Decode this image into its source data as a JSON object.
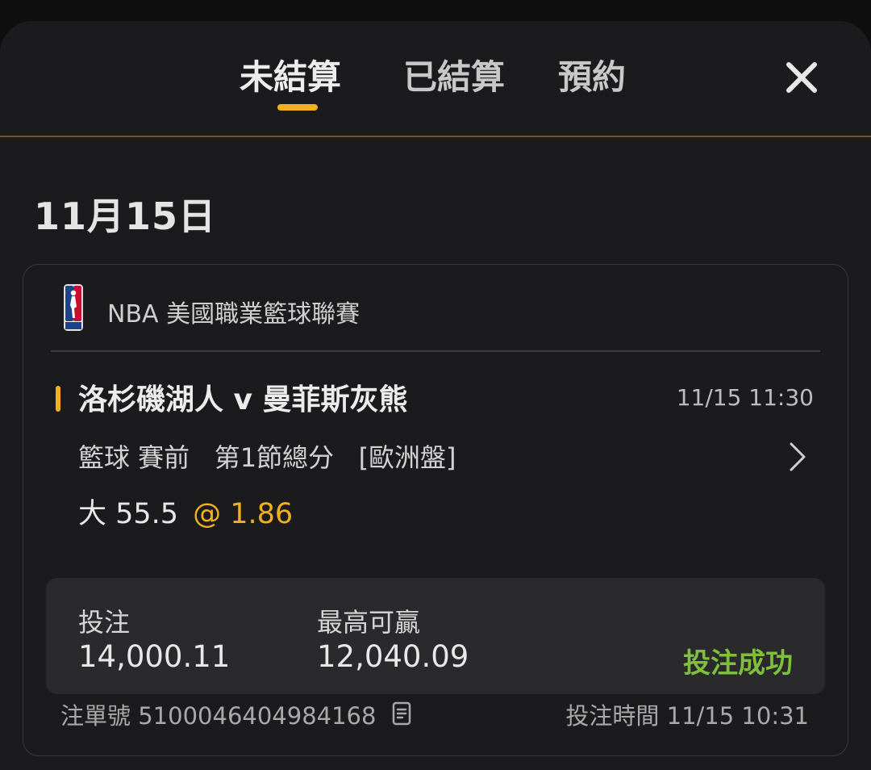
{
  "tabs": [
    {
      "label": "未結算",
      "active": true
    },
    {
      "label": "已結算",
      "active": false
    },
    {
      "label": "預約",
      "active": false
    }
  ],
  "date_heading": "11月15日",
  "bet": {
    "league": "NBA 美國職業籃球聯賽",
    "match_title": "洛杉磯湖人 v 曼菲斯灰熊",
    "match_time": "11/15 11:30",
    "market_info": "籃球 賽前   第1節總分   [歐洲盤]",
    "selection": "大 55.5",
    "odds": "@ 1.86",
    "stake_label": "投注",
    "stake_value": "14,000.11",
    "max_win_label": "最高可贏",
    "max_win_value": "12,040.09",
    "status": "投注成功",
    "ticket_label": "注單號",
    "ticket_number": "5100046404984168",
    "bet_time_label": "投注時間",
    "bet_time_value": "11/15 10:31"
  },
  "colors": {
    "accent": "#f2b01e",
    "success": "#7fbf3c",
    "background": "#1b1b1d",
    "panel": "#2a2a2c"
  },
  "icons": {
    "close": "close-icon",
    "league": "nba-logo-icon",
    "chevron": "chevron-right-icon",
    "copy": "copy-icon"
  }
}
